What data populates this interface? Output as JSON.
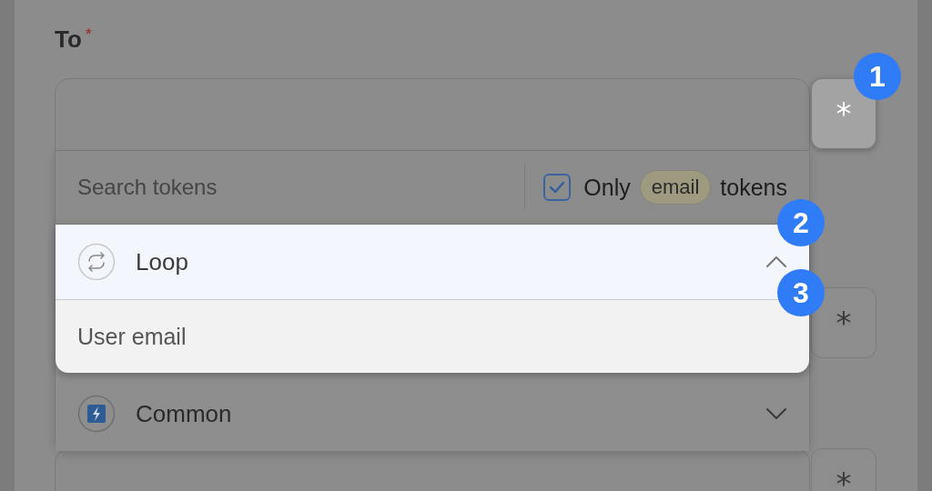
{
  "field": {
    "label": "To",
    "required": true,
    "insert_button": "*"
  },
  "dropdown": {
    "search": {
      "placeholder": "Search tokens"
    },
    "filter": {
      "checked": true,
      "prefix": "Only",
      "chip": "email",
      "suffix": "tokens"
    },
    "groups": [
      {
        "name": "Loop",
        "kind": "loop",
        "expanded": true,
        "highlighted": true,
        "items": [
          "User email"
        ]
      },
      {
        "name": "Common",
        "kind": "common",
        "expanded": false,
        "highlighted": false
      }
    ]
  },
  "other_fields": [
    {
      "insert_button": "*"
    },
    {
      "insert_button": "*"
    }
  ],
  "callouts": [
    "1",
    "2",
    "3"
  ]
}
